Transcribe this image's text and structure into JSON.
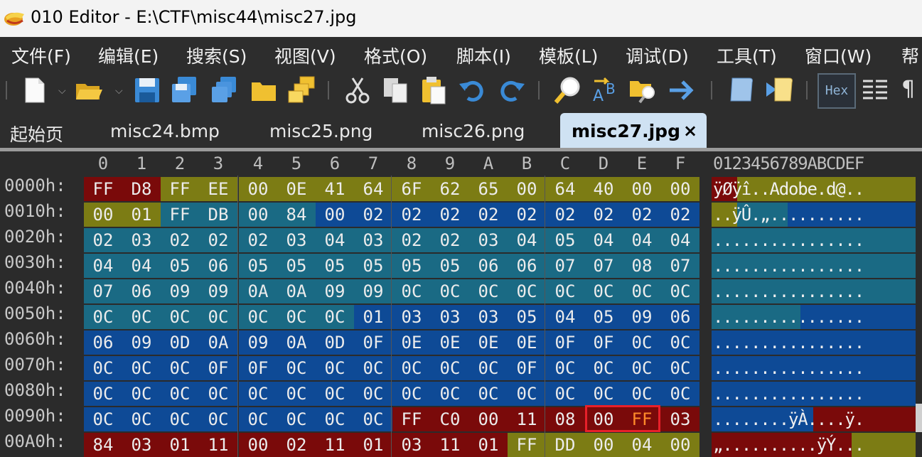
{
  "window": {
    "title": "010 Editor - E:\\CTF\\misc44\\misc27.jpg"
  },
  "menu": [
    "文件(F)",
    "编辑(E)",
    "搜索(S)",
    "视图(V)",
    "格式(O)",
    "脚本(I)",
    "模板(L)",
    "调试(D)",
    "工具(T)",
    "窗口(W)",
    "帮"
  ],
  "toolbar": {
    "icons": [
      "new-file-icon",
      "open-folder-icon",
      "save-icon",
      "save-as-icon",
      "save-all-icon",
      "folder-icon",
      "workspace-icon",
      "cut-icon",
      "copy-icon",
      "paste-icon",
      "undo-icon",
      "redo-icon",
      "find-icon",
      "replace-icon",
      "find-in-files-icon",
      "goto-icon",
      "run-script-icon",
      "run-template-icon",
      "hex-mode-icon",
      "columns-icon",
      "paragraph-icon"
    ],
    "hex_label": "Hex",
    "pilcrow": "¶"
  },
  "tabs": {
    "items": [
      "起始页",
      "misc24.bmp",
      "misc25.png",
      "misc26.png"
    ],
    "active": "misc27.jpg",
    "close": "×"
  },
  "hex": {
    "col_headers": [
      "0",
      "1",
      "2",
      "3",
      "4",
      "5",
      "6",
      "7",
      "8",
      "9",
      "A",
      "B",
      "C",
      "D",
      "E",
      "F"
    ],
    "ascii_header": "0123456789ABCDEF",
    "rows": [
      {
        "addr": "0000h:",
        "bytes": [
          "FF",
          "D8",
          "FF",
          "EE",
          "00",
          "0E",
          "41",
          "64",
          "6F",
          "62",
          "65",
          "00",
          "64",
          "40",
          "00",
          "00"
        ],
        "ascii": "ÿØÿî..Adobe.d@.."
      },
      {
        "addr": "0010h:",
        "bytes": [
          "00",
          "01",
          "FF",
          "DB",
          "00",
          "84",
          "00",
          "02",
          "02",
          "02",
          "02",
          "02",
          "02",
          "02",
          "02",
          "02"
        ],
        "ascii": "..ÿÛ.„.........."
      },
      {
        "addr": "0020h:",
        "bytes": [
          "02",
          "03",
          "02",
          "02",
          "02",
          "03",
          "04",
          "03",
          "02",
          "02",
          "03",
          "04",
          "05",
          "04",
          "04",
          "04"
        ],
        "ascii": "................"
      },
      {
        "addr": "0030h:",
        "bytes": [
          "04",
          "04",
          "05",
          "06",
          "05",
          "05",
          "05",
          "05",
          "05",
          "05",
          "06",
          "06",
          "07",
          "07",
          "08",
          "07"
        ],
        "ascii": "................"
      },
      {
        "addr": "0040h:",
        "bytes": [
          "07",
          "06",
          "09",
          "09",
          "0A",
          "0A",
          "09",
          "09",
          "0C",
          "0C",
          "0C",
          "0C",
          "0C",
          "0C",
          "0C",
          "0C"
        ],
        "ascii": "................"
      },
      {
        "addr": "0050h:",
        "bytes": [
          "0C",
          "0C",
          "0C",
          "0C",
          "0C",
          "0C",
          "0C",
          "01",
          "03",
          "03",
          "03",
          "05",
          "04",
          "05",
          "09",
          "06"
        ],
        "ascii": "................"
      },
      {
        "addr": "0060h:",
        "bytes": [
          "06",
          "09",
          "0D",
          "0A",
          "09",
          "0A",
          "0D",
          "0F",
          "0E",
          "0E",
          "0E",
          "0E",
          "0F",
          "0F",
          "0C",
          "0C"
        ],
        "ascii": "................"
      },
      {
        "addr": "0070h:",
        "bytes": [
          "0C",
          "0C",
          "0C",
          "0F",
          "0F",
          "0C",
          "0C",
          "0C",
          "0C",
          "0C",
          "0C",
          "0F",
          "0C",
          "0C",
          "0C",
          "0C"
        ],
        "ascii": "................"
      },
      {
        "addr": "0080h:",
        "bytes": [
          "0C",
          "0C",
          "0C",
          "0C",
          "0C",
          "0C",
          "0C",
          "0C",
          "0C",
          "0C",
          "0C",
          "0C",
          "0C",
          "0C",
          "0C",
          "0C"
        ],
        "ascii": "................"
      },
      {
        "addr": "0090h:",
        "bytes": [
          "0C",
          "0C",
          "0C",
          "0C",
          "0C",
          "0C",
          "0C",
          "0C",
          "FF",
          "C0",
          "00",
          "11",
          "08",
          "00",
          "FF",
          "03"
        ],
        "ascii": "........ÿÀ....ÿ."
      },
      {
        "addr": "00A0h:",
        "bytes": [
          "84",
          "03",
          "01",
          "11",
          "00",
          "02",
          "11",
          "01",
          "03",
          "11",
          "01",
          "FF",
          "DD",
          "00",
          "04",
          "00"
        ],
        "ascii": "„..........ÿÝ..."
      }
    ]
  },
  "colors": {
    "dark_red": "#7a0a0a",
    "olive": "#7c7c14",
    "teal": "#1a6a84",
    "blue": "#0e4a96",
    "navy": "#0a3a8c",
    "highlight_border": "#e8202a",
    "highlight_text": "#ff8a2a"
  }
}
